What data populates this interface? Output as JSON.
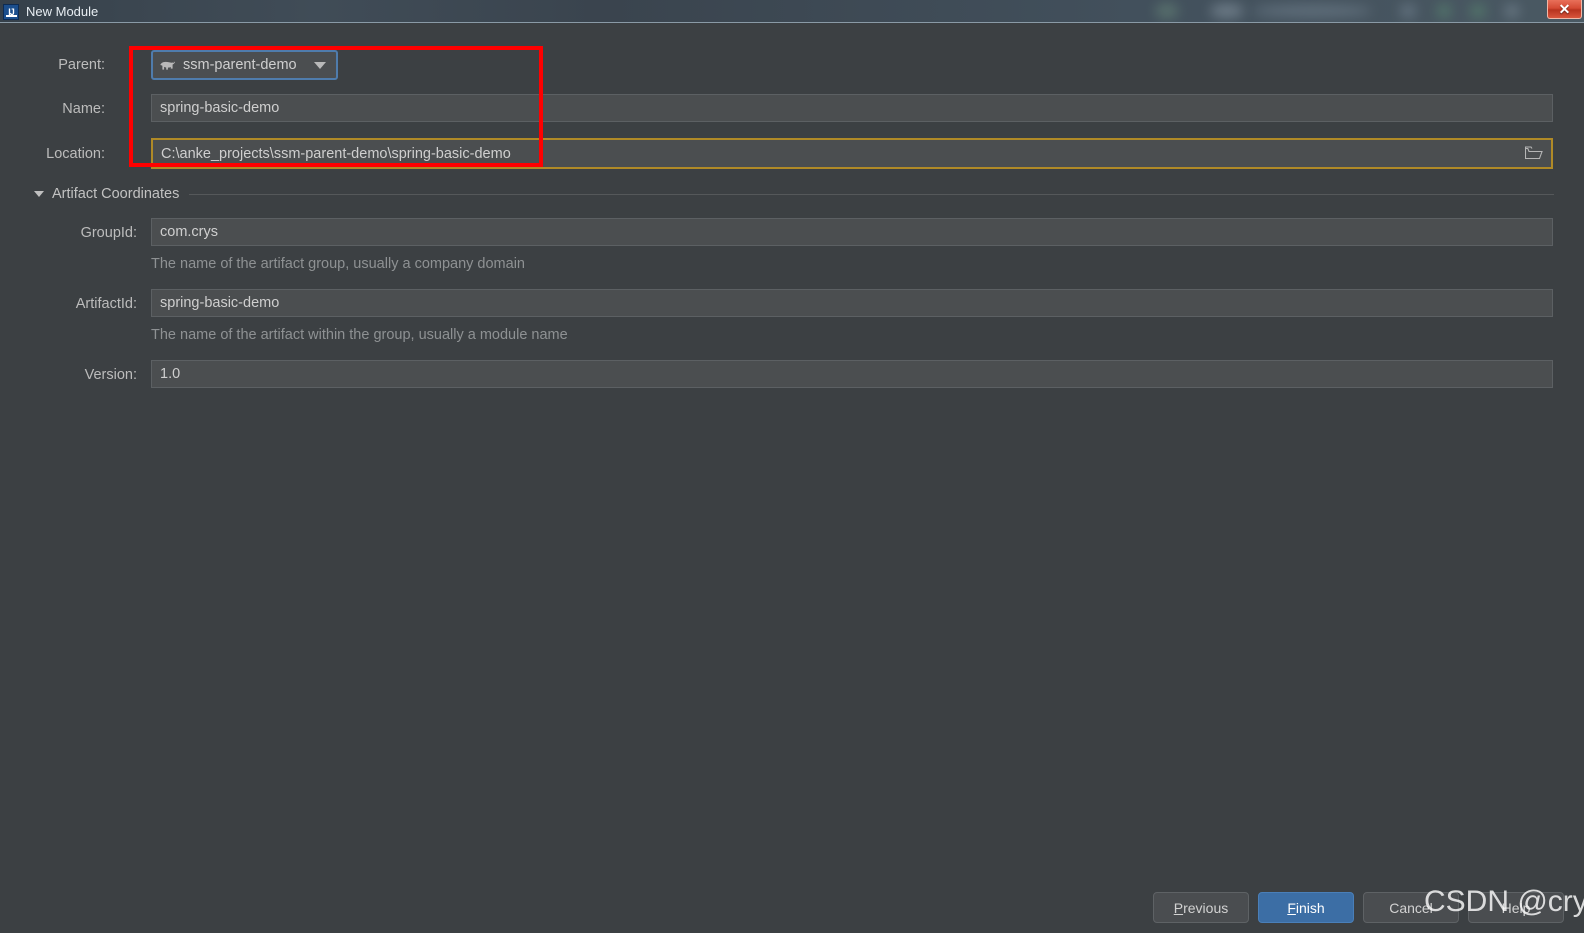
{
  "window": {
    "title": "New Module",
    "icon": "intellij-idea-icon",
    "close_label": "✕"
  },
  "form": {
    "parent": {
      "label": "Parent:",
      "value": "ssm-parent-demo",
      "icon": "maven-elephant-icon"
    },
    "name": {
      "label": "Name:",
      "value": "spring-basic-demo"
    },
    "location": {
      "label": "Location:",
      "value": "C:\\anke_projects\\ssm-parent-demo\\spring-basic-demo",
      "browse_icon": "folder-icon"
    }
  },
  "artifact_coordinates": {
    "section_label": "Artifact Coordinates",
    "group_id": {
      "label": "GroupId:",
      "value": "com.crys",
      "hint": "The name of the artifact group, usually a company domain"
    },
    "artifact_id": {
      "label": "ArtifactId:",
      "value": "spring-basic-demo",
      "hint": "The name of the artifact within the group, usually a module name"
    },
    "version": {
      "label": "Version:",
      "value": "1.0"
    }
  },
  "buttons": {
    "previous": {
      "mnemonic": "P",
      "rest": "revious"
    },
    "finish": {
      "mnemonic": "F",
      "rest": "inish"
    },
    "cancel": "Cancel",
    "help": "Help"
  },
  "watermark": {
    "text": "CSDN @crysw"
  },
  "colors": {
    "background": "#3c4043",
    "field_background": "#4b4e50",
    "accent_primary": "#3c6ea5",
    "focus_border": "#4f7cac",
    "warning_border": "#b08a27",
    "annotation": "#ff0000",
    "close_button": "#d44a34"
  }
}
